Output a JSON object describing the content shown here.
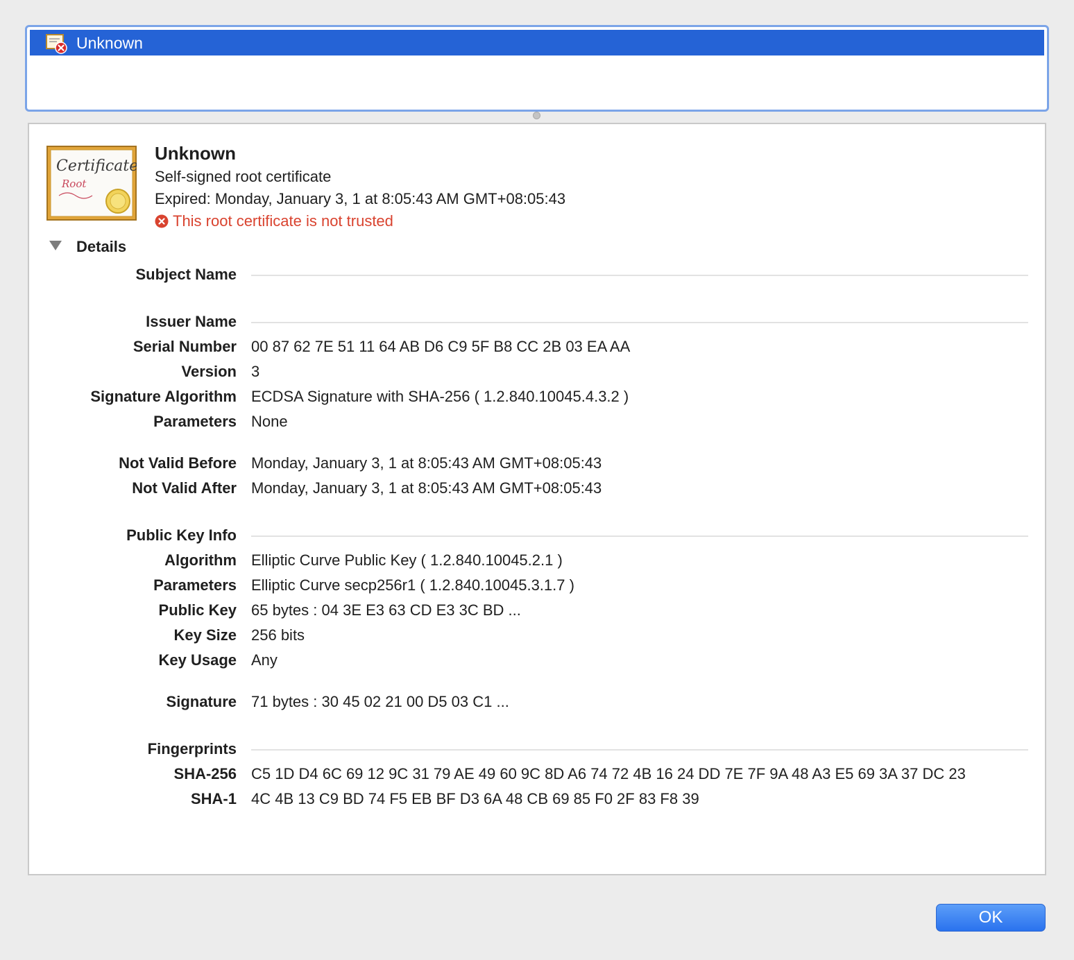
{
  "cert_list": {
    "selected_item": "Unknown",
    "icon": "certificate-untrusted-icon"
  },
  "header": {
    "title": "Unknown",
    "subtitle": "Self-signed root certificate",
    "expired": "Expired: Monday, January 3, 1 at 8:05:43 AM GMT+08:05:43",
    "warning": "This root certificate is not trusted",
    "icon": "certificate-icon",
    "icon_text_main": "Certificate",
    "icon_text_sub": "Root"
  },
  "details": {
    "toggle_label": "Details",
    "rows": [
      {
        "label": "Subject Name",
        "value": ""
      },
      {
        "label": "Issuer Name",
        "value": ""
      },
      {
        "label": "Serial Number",
        "value": "00 87 62 7E 51 11 64 AB D6 C9 5F B8 CC 2B 03 EA AA"
      },
      {
        "label": "Version",
        "value": "3"
      },
      {
        "label": "Signature Algorithm",
        "value": "ECDSA Signature with SHA-256 ( 1.2.840.10045.4.3.2 )"
      },
      {
        "label": "Parameters",
        "value": "None"
      },
      {
        "label": "Not Valid Before",
        "value": "Monday, January 3, 1 at 8:05:43 AM GMT+08:05:43"
      },
      {
        "label": "Not Valid After",
        "value": "Monday, January 3, 1 at 8:05:43 AM GMT+08:05:43"
      },
      {
        "label": "Public Key Info",
        "value": ""
      },
      {
        "label": "Algorithm",
        "value": "Elliptic Curve Public Key ( 1.2.840.10045.2.1 )"
      },
      {
        "label": "Parameters",
        "value": "Elliptic Curve secp256r1 ( 1.2.840.10045.3.1.7 )"
      },
      {
        "label": "Public Key",
        "value": "65 bytes : 04 3E E3 63 CD E3 3C BD ..."
      },
      {
        "label": "Key Size",
        "value": "256 bits"
      },
      {
        "label": "Key Usage",
        "value": "Any"
      },
      {
        "label": "Signature",
        "value": "71 bytes : 30 45 02 21 00 D5 03 C1 ..."
      },
      {
        "label": "Fingerprints",
        "value": ""
      },
      {
        "label": "SHA-256",
        "value": "C5 1D D4 6C 69 12 9C 31 79 AE 49 60 9C 8D A6 74 72 4B 16 24 DD 7E 7F 9A 48 A3 E5 69 3A 37 DC 23"
      },
      {
        "label": "SHA-1",
        "value": "4C 4B 13 C9 BD 74 F5 EB BF D3 6A 48 CB 69 85 F0 2F 83 F8 39"
      }
    ]
  },
  "footer": {
    "ok_label": "OK"
  },
  "colors": {
    "selection": "#2563d6",
    "warning": "#d9432f",
    "ok_button": "#2a72ee"
  }
}
